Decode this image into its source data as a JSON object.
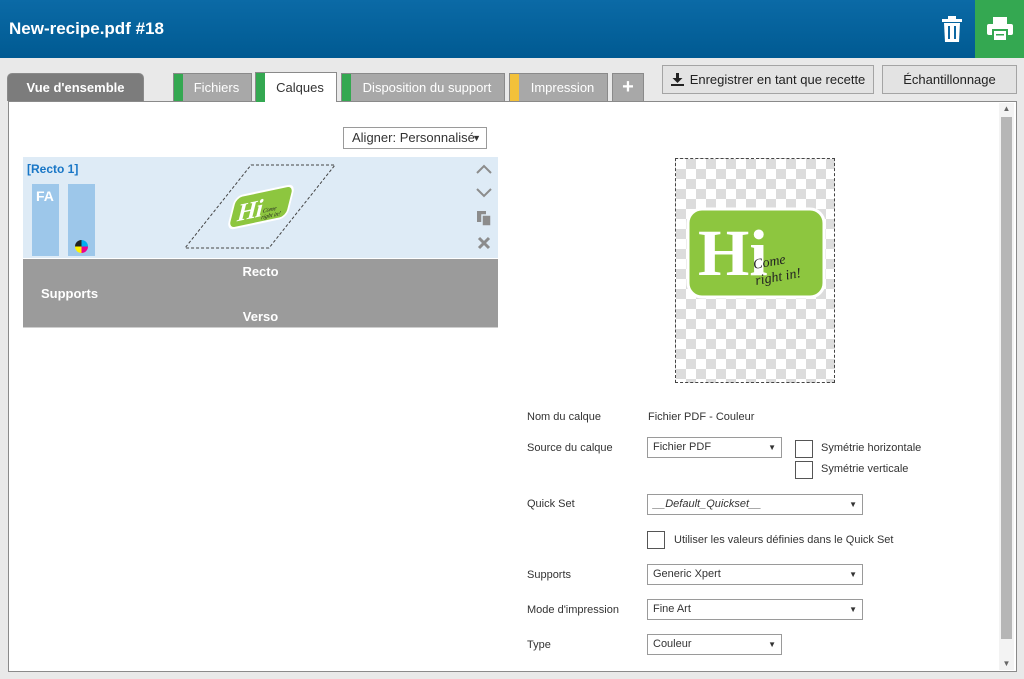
{
  "header": {
    "title": "New-recipe.pdf #18"
  },
  "tabs": [
    {
      "label": "Vue d'ensemble"
    },
    {
      "label": "Fichiers",
      "flag_color": "#34a851"
    },
    {
      "label": "Calques",
      "flag_color": "#34a851"
    },
    {
      "label": "Disposition du support",
      "flag_color": "#34a851"
    },
    {
      "label": "Impression",
      "flag_color": "#f3c13a"
    }
  ],
  "add_tab_label": "+",
  "toolbar": {
    "save_recipe_label": "Enregistrer en tant que recette",
    "sampling_label": "Échantillonnage"
  },
  "align": {
    "value": "Aligner: Personnalisé"
  },
  "layer_card": {
    "title": "[Recto 1]",
    "fa_label": "FA"
  },
  "supports_box": {
    "recto": "Recto",
    "label": "Supports",
    "verso": "Verso"
  },
  "logo": {
    "big": "Hi",
    "tagline_1": "Come",
    "tagline_2": "right in!"
  },
  "properties": {
    "name_label": "Nom du calque",
    "name_value": "Fichier PDF - Couleur",
    "source_label": "Source du calque",
    "source_value": "Fichier PDF",
    "flip_h_label": "Symétrie horizontale",
    "flip_v_label": "Symétrie verticale",
    "quickset_label": "Quick Set",
    "quickset_value": "__Default_Quickset__",
    "use_quickset_label": "Utiliser les valeurs définies dans le Quick Set",
    "supports_label": "Supports",
    "supports_value": "Generic Xpert",
    "mode_label": "Mode d'impression",
    "mode_value": "Fine Art",
    "type_label": "Type",
    "type_value": "Couleur"
  },
  "colors": {
    "header_blue": "#005a92",
    "print_green": "#34a851",
    "accent_blue": "#1876c6",
    "logo_green": "#8dc63f"
  }
}
